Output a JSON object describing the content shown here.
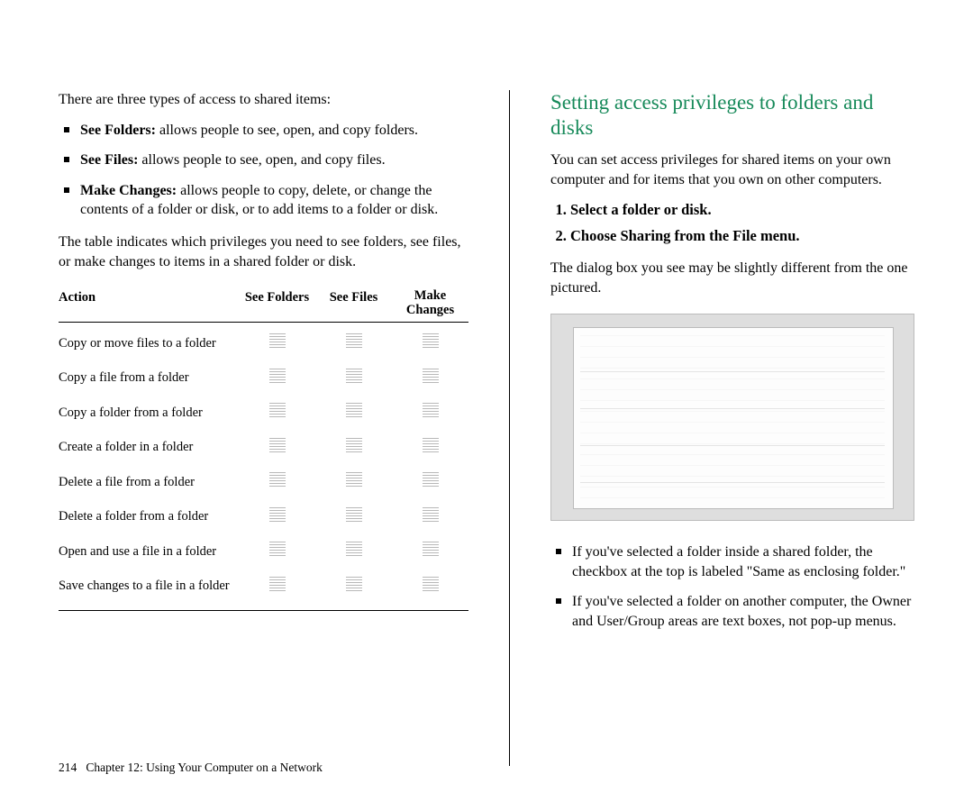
{
  "left": {
    "intro": "There are three types of access to shared items:",
    "bullets": [
      {
        "term": "See Folders:",
        "text": " allows people to see, open, and copy folders."
      },
      {
        "term": "See Files:",
        "text": " allows people to see, open, and copy files."
      },
      {
        "term": "Make Changes:",
        "text": " allows people to copy, delete, or change the contents of a folder or disk, or to add items to a folder or disk."
      }
    ],
    "table_intro": "The table indicates which privileges you need to see folders, see files, or make changes to items in a shared folder or disk.",
    "table": {
      "headers": {
        "action": "Action",
        "see_folders": "See Folders",
        "see_files": "See Files",
        "make_changes_top": "Make",
        "make_changes_bottom": "Changes"
      },
      "rows": [
        "Copy or move files to a folder",
        "Copy a file from a folder",
        "Copy a folder from a folder",
        "Create a folder in a folder",
        "Delete a file from a folder",
        "Delete a folder from a folder",
        "Open and use a file in a folder",
        "Save changes to a file in a folder"
      ]
    }
  },
  "right": {
    "heading": "Setting access privileges to folders and disks",
    "intro": "You can set access privileges for shared items on your own computer and for items that you own on other computers.",
    "steps": [
      "Select a folder or disk.",
      "Choose Sharing from the File menu."
    ],
    "after_steps": "The dialog box you see may be slightly different from the one pictured.",
    "bullets": [
      "If you've selected a folder inside a shared folder, the checkbox at the top is labeled \"Same as enclosing folder.\"",
      "If you've selected a folder on another computer, the Owner and User/Group areas are text boxes, not pop-up menus."
    ]
  },
  "footer": {
    "page_number": "214",
    "chapter": "Chapter 12: Using Your Computer on a Network"
  }
}
